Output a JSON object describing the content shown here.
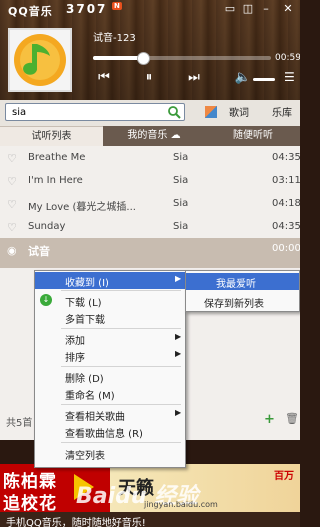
{
  "titlebar": {
    "brand": "QQ音乐",
    "qq_number": "3707",
    "badge": "N"
  },
  "player": {
    "song": "试音-123",
    "time": "00:59",
    "progress": 0.28
  },
  "search": {
    "value": "sia",
    "placeholder": ""
  },
  "toolbar": {
    "lyric": "歌词",
    "library": "乐库"
  },
  "tabs": [
    {
      "label": "试听列表",
      "active": true
    },
    {
      "label": "我的音乐",
      "active": false
    },
    {
      "label": "随便听听",
      "active": false
    }
  ],
  "songs": [
    {
      "name": "Breathe Me",
      "artist": "Sia",
      "duration": "04:35"
    },
    {
      "name": "I'm In Here",
      "artist": "Sia",
      "duration": "03:11"
    },
    {
      "name": "My Love (暮光之城插...",
      "artist": "Sia",
      "duration": "04:18"
    },
    {
      "name": "Sunday",
      "artist": "Sia",
      "duration": "04:35"
    },
    {
      "name": "试音",
      "artist": "",
      "duration": "00:00"
    }
  ],
  "list_footer": {
    "count": "共5首"
  },
  "context_menu": {
    "items": [
      {
        "label": "收藏到 (I)",
        "has_sub": true,
        "highlighted": true
      },
      {
        "label": "下载 (L)",
        "has_sub": false
      },
      {
        "label": "多首下载",
        "has_sub": false
      },
      {
        "label": "添加",
        "has_sub": true
      },
      {
        "label": "排序",
        "has_sub": true
      },
      {
        "label": "删除 (D)",
        "has_sub": false
      },
      {
        "label": "重命名 (M)",
        "has_sub": false
      },
      {
        "label": "查看相关歌曲",
        "has_sub": true
      },
      {
        "label": "查看歌曲信息 (R)",
        "has_sub": false
      },
      {
        "label": "清空列表",
        "has_sub": false
      }
    ],
    "submenu": [
      {
        "label": "我最爱听",
        "highlighted": true
      },
      {
        "label": "保存到新列表",
        "highlighted": false
      }
    ]
  },
  "ad": {
    "line1": "陈柏霖",
    "line2": "追校花",
    "brand": "天籁",
    "tag": "百万"
  },
  "watermark": {
    "main": "Baidu 经验",
    "url": "jingyan.baidu.com"
  },
  "bottom": {
    "text": "手机QQ音乐，随时随地好音乐!"
  }
}
